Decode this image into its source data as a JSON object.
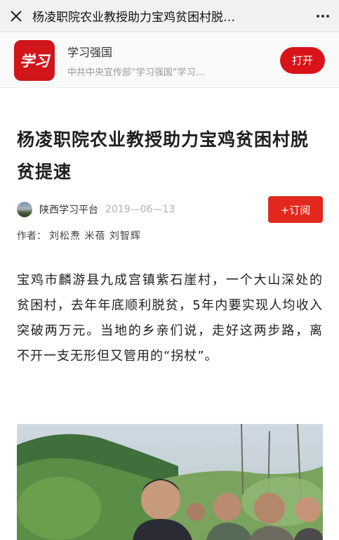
{
  "topbar": {
    "title": "杨凌职院农业教授助力宝鸡贫困村脱…"
  },
  "app_banner": {
    "logo_text": "学习",
    "name": "学习强国",
    "description": "中共中央宣传部“学习强国”学习…",
    "open_label": "打开"
  },
  "article": {
    "title": "杨凌职院农业教授助力宝鸡贫困村脱贫提速",
    "source": "陕西学习平台",
    "date": "2019—06—13",
    "subscribe_label": "+订阅",
    "author_prefix": "作者：",
    "authors": "刘松焘 米蓓 刘智辉",
    "paragraph": "宝鸡市麟游县九成宫镇紫石崖村，一个大山深处的贫困村，去年年底顺利脱贫，5年内要实现人均收入突破两万元。当地的乡亲们说，走好这两步路，离不开一支无形但又管用的“拐杖”。"
  },
  "colors": {
    "brand_red": "#d8141a",
    "subscribe_red": "#e2281d",
    "date_gray": "#b0b0b0"
  },
  "icons": {
    "close": "close-icon",
    "more": "more-icon"
  }
}
